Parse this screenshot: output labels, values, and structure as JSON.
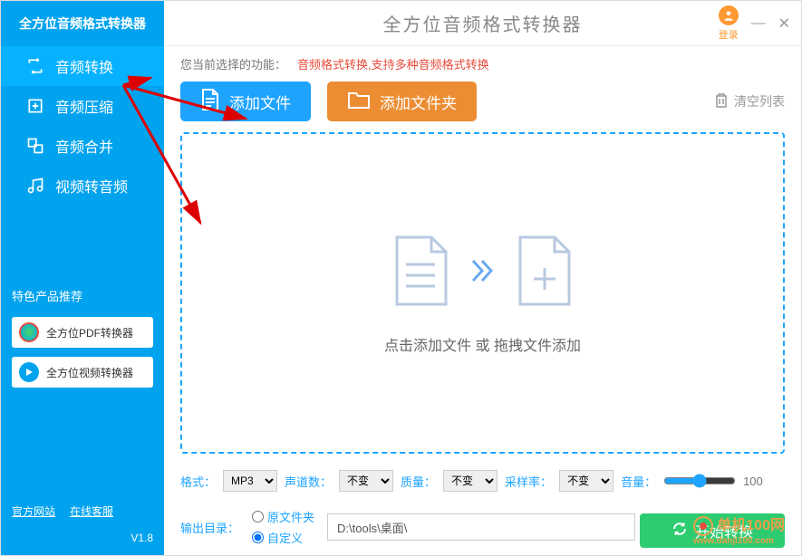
{
  "sidebar": {
    "app_name": "全方位音频格式转换器",
    "nav": [
      {
        "label": "音频转换",
        "active": true
      },
      {
        "label": "音频压缩",
        "active": false
      },
      {
        "label": "音频合并",
        "active": false
      },
      {
        "label": "视频转音频",
        "active": false
      }
    ],
    "promo_title": "特色产品推荐",
    "promo": [
      {
        "label": "全方位PDF转换器"
      },
      {
        "label": "全方位视频转换器"
      }
    ],
    "footer_links": [
      "官方网站",
      "在线客服"
    ],
    "version": "V1.8"
  },
  "titlebar": {
    "title": "全方位音频格式转换器",
    "login": "登录"
  },
  "func": {
    "label": "您当前选择的功能：",
    "desc": "音频格式转换,支持多种音频格式转换"
  },
  "actions": {
    "add_file": "添加文件",
    "add_folder": "添加文件夹",
    "clear": "清空列表"
  },
  "dropzone": {
    "text": "点击添加文件 或 拖拽文件添加"
  },
  "options": {
    "format_label": "格式：",
    "format_value": "MP3",
    "channels_label": "声道数：",
    "channels_value": "不变",
    "quality_label": "质量：",
    "quality_value": "不变",
    "samplerate_label": "采样率：",
    "samplerate_value": "不变",
    "volume_label": "音量：",
    "volume_value": "100"
  },
  "output": {
    "label": "输出目录：",
    "radio_original": "原文件夹",
    "radio_custom": "自定义",
    "path": "D:\\tools\\桌面\\"
  },
  "convert": {
    "label": "开始转换"
  },
  "watermark": {
    "text": "单机100网",
    "url": "www.danji100.com"
  }
}
